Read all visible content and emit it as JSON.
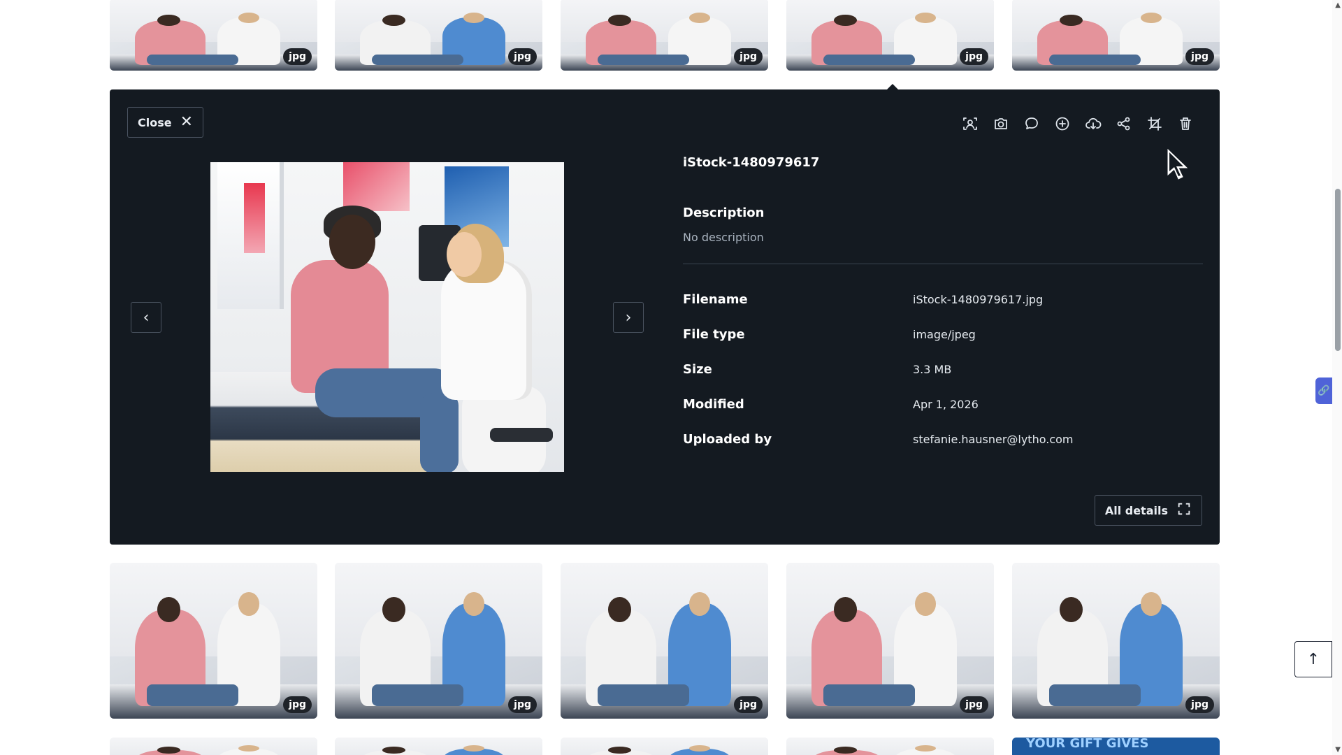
{
  "thumbnails": {
    "badge": "jpg",
    "rows": [
      {
        "items": [
          {
            "patient": "#e4939b",
            "clinician": "#f5f5f5"
          },
          {
            "patient": "#f2f2f2",
            "clinician": "#4f8bd0"
          },
          {
            "patient": "#e4939b",
            "clinician": "#f5f5f5"
          },
          {
            "patient": "#e4939b",
            "clinician": "#f5f5f5"
          },
          {
            "patient": "#e4939b",
            "clinician": "#f5f5f5"
          }
        ]
      },
      {
        "items": [
          {
            "patient": "#e4939b",
            "clinician": "#f5f5f5"
          },
          {
            "patient": "#f2f2f2",
            "clinician": "#4f8bd0"
          },
          {
            "patient": "#f2f2f2",
            "clinician": "#4f8bd0"
          },
          {
            "patient": "#e4939b",
            "clinician": "#f5f5f5"
          },
          {
            "patient": "#f2f2f2",
            "clinician": "#4f8bd0"
          }
        ]
      },
      {
        "items": [
          {
            "patient": "#e4939b",
            "clinician": "#f5f5f5"
          },
          {
            "patient": "#f2f2f2",
            "clinician": "#4f8bd0"
          },
          {
            "patient": "#f2f2f2",
            "clinician": "#4f8bd0"
          },
          {
            "patient": "#e4939b",
            "clinician": "#f5f5f5"
          },
          {
            "patient": "#1d5aa0",
            "clinician": "#1d5aa0",
            "text": "YOUR GIFT GIVES"
          }
        ]
      }
    ]
  },
  "detail": {
    "close_label": "Close",
    "close_icon": "close-icon",
    "toolbar_icons": [
      "face-recognition-icon",
      "camera-icon",
      "comment-icon",
      "add-icon",
      "download-cloud-icon",
      "share-icon",
      "crop-icon",
      "trash-icon"
    ],
    "title": "iStock-1480979617",
    "description_label": "Description",
    "description_value": "No description",
    "fields": [
      {
        "label": "Filename",
        "value": "iStock-1480979617.jpg"
      },
      {
        "label": "File type",
        "value": "image/jpeg"
      },
      {
        "label": "Size",
        "value": "3.3 MB"
      },
      {
        "label": "Modified",
        "value": "Apr 1, 2026"
      },
      {
        "label": "Uploaded by",
        "value": "stefanie.hausner@lytho.com"
      }
    ],
    "all_details_label": "All details",
    "prev_icon": "chevron-left-icon",
    "next_icon": "chevron-right-icon"
  },
  "colors": {
    "panel_bg": "#141a21",
    "page_bg": "#ffffff",
    "side_tab": "#4f63d8"
  }
}
